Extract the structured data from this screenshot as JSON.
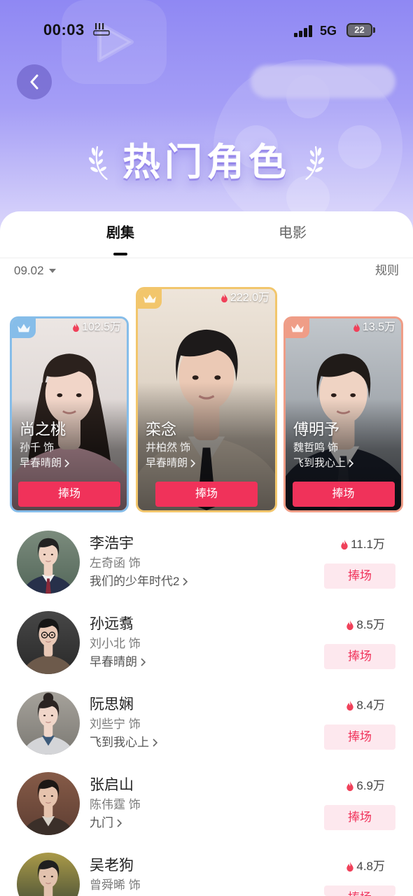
{
  "theme": {
    "accent": "#f0325a",
    "accent_soft": "#fde8ee",
    "gold": "#f2c66c",
    "blue": "#86bde9",
    "orange": "#ef9d87",
    "header_top": "#8f88f3",
    "header_bottom": "#dedafb"
  },
  "status_bar": {
    "time": "00:03",
    "network": "5G",
    "battery": "22"
  },
  "header": {
    "title": "热门角色"
  },
  "tabs": [
    {
      "label": "剧集",
      "active": true
    },
    {
      "label": "电影",
      "active": false
    }
  ],
  "filter": {
    "date": "09.02",
    "rules_label": "规则"
  },
  "top3": [
    {
      "heat": "102.5万",
      "name": "尚之桃",
      "actor": "孙千 饰",
      "show": "早春晴朗",
      "button": "捧场",
      "crown": "blue"
    },
    {
      "heat": "222.0万",
      "name": "栾念",
      "actor": "井柏然 饰",
      "show": "早春晴朗",
      "button": "捧场",
      "crown": "gold"
    },
    {
      "heat": "13.5万",
      "name": "傅明予",
      "actor": "魏哲鸣 饰",
      "show": "飞到我心上",
      "button": "捧场",
      "crown": "orange"
    }
  ],
  "list": [
    {
      "name": "李浩宇",
      "actor": "左奇函 饰",
      "show": "我们的少年时代2",
      "heat": "11.1万",
      "button": "捧场"
    },
    {
      "name": "孙远翥",
      "actor": "刘小北 饰",
      "show": "早春晴朗",
      "heat": "8.5万",
      "button": "捧场"
    },
    {
      "name": "阮思娴",
      "actor": "刘些宁 饰",
      "show": "飞到我心上",
      "heat": "8.4万",
      "button": "捧场"
    },
    {
      "name": "张启山",
      "actor": "陈伟霆 饰",
      "show": "九门",
      "heat": "6.9万",
      "button": "捧场"
    },
    {
      "name": "吴老狗",
      "actor": "曾舜晞 饰",
      "heat": "4.8万",
      "button": "捧场"
    }
  ]
}
